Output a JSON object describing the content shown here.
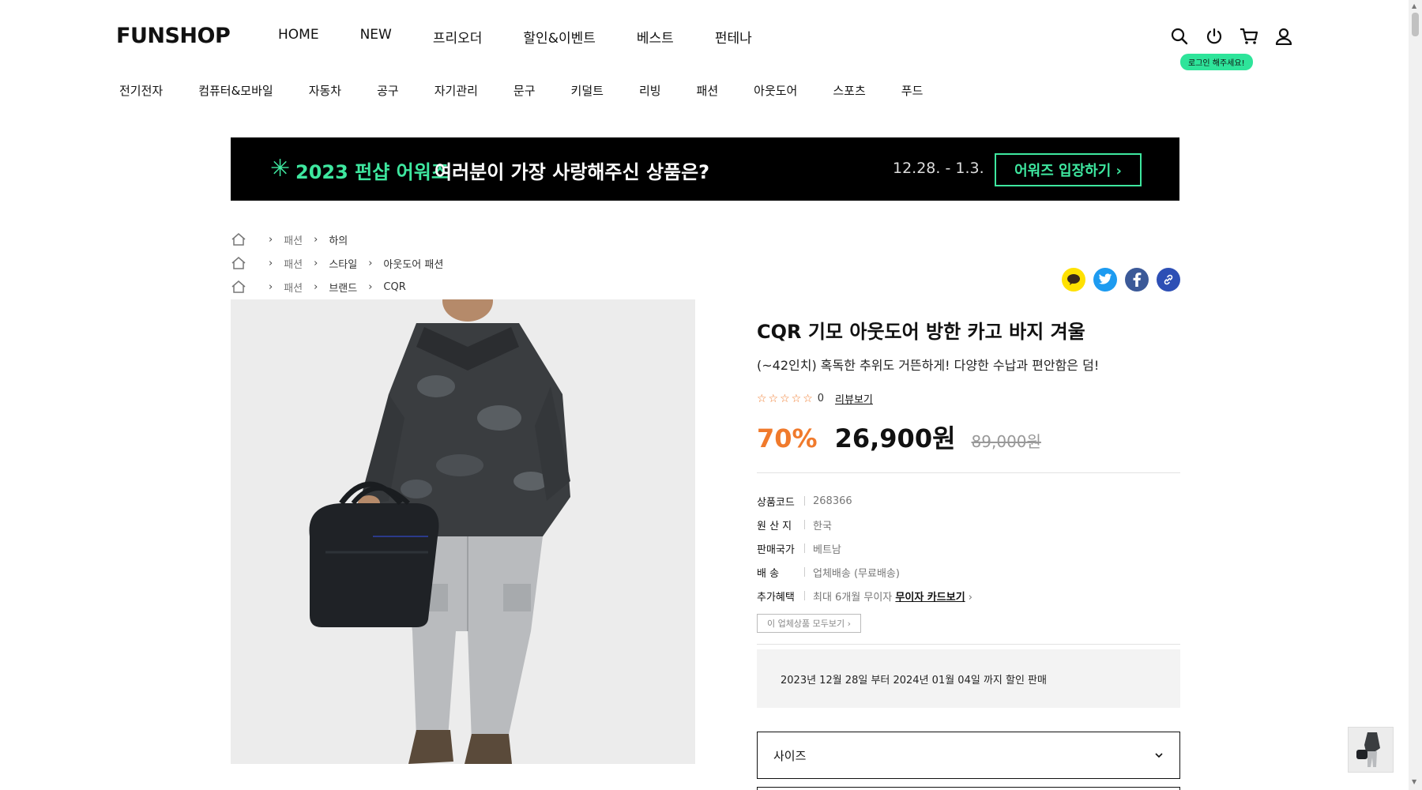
{
  "header": {
    "logo": "FUNSHOP",
    "nav": [
      "HOME",
      "NEW",
      "프리오더",
      "할인&이벤트",
      "베스트",
      "펀테나"
    ],
    "login_tip": "로그인 해주세요!"
  },
  "categories": [
    "전기전자",
    "컴퓨터&모바일",
    "자동차",
    "공구",
    "자기관리",
    "문구",
    "키덜트",
    "리빙",
    "패션",
    "아웃도어",
    "스포츠",
    "푸드"
  ],
  "banner": {
    "star": "✳",
    "title": "2023 펀샵 어워즈",
    "subtitle": "여러분이 가장 사랑해주신 상품은?",
    "date": "12.28. - 1.3.",
    "button": "어워즈 입장하기 ›"
  },
  "breadcrumbs": [
    [
      "패션",
      "하의"
    ],
    [
      "패션",
      "스타일",
      "아웃도어 패션"
    ],
    [
      "패션",
      "브랜드",
      "CQR"
    ]
  ],
  "product": {
    "title": "CQR 기모 아웃도어 방한 카고 바지 겨울",
    "subtitle": "(~42인치) 혹독한 추위도 거뜬하게! 다양한 수납과 편안함은 덤!",
    "stars": "☆☆☆☆☆",
    "review_count": "0",
    "review_link": "리뷰보기",
    "discount": "70%",
    "price": "26,900원",
    "original_price": "89,000원",
    "specs": [
      {
        "key": "상품코드",
        "value": "268366"
      },
      {
        "key": "원 산 지",
        "value": "한국"
      },
      {
        "key": "판매국가",
        "value": "베트남"
      },
      {
        "key": "배 송",
        "value": "업체배송 (무료배송)"
      },
      {
        "key": "추가혜택",
        "value": "최대 6개월 무이자",
        "link": "무이자 카드보기"
      }
    ],
    "all_products_button": "이 업체상품 모두보기 ›",
    "sale_notice": "2023년 12월 28일 부터 2024년 01월 04일 까지 할인 판매",
    "size_select": "사이즈"
  },
  "colors": {
    "accent_orange": "#f07a2c",
    "accent_green": "#3ee79f",
    "kakao_yellow": "#ffe100",
    "twitter_blue": "#1d9bf0",
    "facebook_blue": "#3b5998",
    "link_blue": "#2d4fb5"
  }
}
